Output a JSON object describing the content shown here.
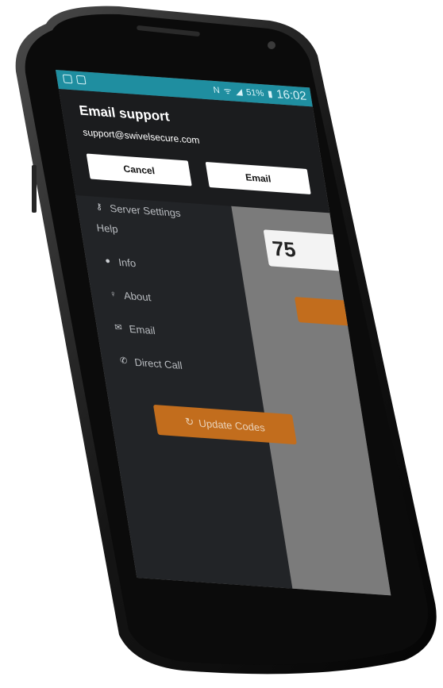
{
  "status_bar": {
    "time": "16:02",
    "battery": "51%",
    "left_icons": [
      "image-icon",
      "message-icon"
    ],
    "right_icons": [
      "nfc-icon",
      "wifi-icon",
      "signal-icon",
      "battery-icon"
    ]
  },
  "dialog": {
    "title": "Email support",
    "email": "support@swivelsecure.com",
    "cancel_label": "Cancel",
    "email_label": "Email"
  },
  "drawer": {
    "server_settings": "Server Settings",
    "help_header": "Help",
    "items": [
      {
        "label": "Info",
        "icon": "info-icon"
      },
      {
        "label": "About",
        "icon": "bulb-icon"
      },
      {
        "label": "Email",
        "icon": "mail-icon"
      },
      {
        "label": "Direct Call",
        "icon": "phone-icon"
      }
    ],
    "update_label": "Update Codes"
  },
  "main": {
    "code_partial": "75"
  },
  "colors": {
    "status_bar": "#1f8ea0",
    "accent": "#c26d1d",
    "drawer": "#222427",
    "dialog": "#1b1c1e"
  }
}
